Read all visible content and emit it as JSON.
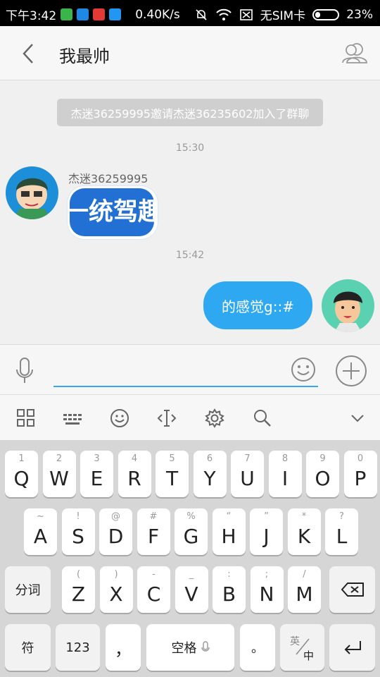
{
  "status_bar": {
    "time": "下午3:42",
    "speed": "0.40K/s",
    "sim": "无SIM卡",
    "battery": "23%"
  },
  "header": {
    "title": "我最帅",
    "back_icon": "chevron-left-icon",
    "members_icon": "group-members-icon"
  },
  "chat": {
    "system_message": "杰迷36259995邀请杰迷36235602加入了群聊",
    "time_1": "15:30",
    "sender_name": "杰迷36259995",
    "sticker_text": "一统驾趣",
    "time_2": "15:42",
    "outgoing_message": "的感觉g::#"
  },
  "keyboard": {
    "row1": [
      {
        "main": "Q",
        "sub": "1"
      },
      {
        "main": "W",
        "sub": "2"
      },
      {
        "main": "E",
        "sub": "3"
      },
      {
        "main": "R",
        "sub": "4"
      },
      {
        "main": "T",
        "sub": "5"
      },
      {
        "main": "Y",
        "sub": "6"
      },
      {
        "main": "U",
        "sub": "7"
      },
      {
        "main": "I",
        "sub": "8"
      },
      {
        "main": "O",
        "sub": "9"
      },
      {
        "main": "P",
        "sub": "0"
      }
    ],
    "row2": [
      {
        "main": "A",
        "sub": "~"
      },
      {
        "main": "S",
        "sub": "!"
      },
      {
        "main": "D",
        "sub": "@"
      },
      {
        "main": "F",
        "sub": "#"
      },
      {
        "main": "G",
        "sub": "%"
      },
      {
        "main": "H",
        "sub": "“"
      },
      {
        "main": "J",
        "sub": "”"
      },
      {
        "main": "K",
        "sub": "*"
      },
      {
        "main": "L",
        "sub": "?"
      }
    ],
    "row3": [
      {
        "main": "Z",
        "sub": "("
      },
      {
        "main": "X",
        "sub": ")"
      },
      {
        "main": "C",
        "sub": "-"
      },
      {
        "main": "V",
        "sub": "_"
      },
      {
        "main": "B",
        "sub": ":"
      },
      {
        "main": "N",
        "sub": ";"
      },
      {
        "main": "M",
        "sub": "/"
      }
    ],
    "fenci": "分词",
    "fu": "符",
    "num": "123",
    "comma": "，",
    "space": "空格",
    "period": "。",
    "lang_top": "英",
    "lang_bottom": "中"
  }
}
